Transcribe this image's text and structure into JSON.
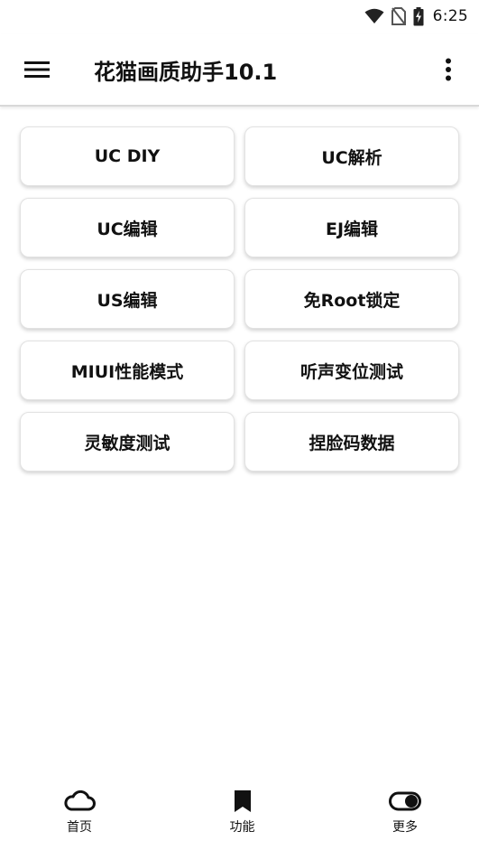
{
  "status_bar": {
    "time": "6:25",
    "icons": [
      "wifi-icon",
      "no-sim-icon",
      "battery-charging-icon"
    ]
  },
  "app_bar": {
    "title": "花猫画质助手10.1",
    "menu_icon": "hamburger-menu-icon",
    "overflow_icon": "more-vert-icon"
  },
  "features": [
    {
      "label": "UC DIY"
    },
    {
      "label": "UC解析"
    },
    {
      "label": "UC编辑"
    },
    {
      "label": "EJ编辑"
    },
    {
      "label": "US编辑"
    },
    {
      "label": "免Root锁定"
    },
    {
      "label": "MIUI性能模式"
    },
    {
      "label": "听声变位测试"
    },
    {
      "label": "灵敏度测试"
    },
    {
      "label": "捏脸码数据"
    }
  ],
  "bottom_nav": [
    {
      "label": "首页",
      "icon": "cloud-icon"
    },
    {
      "label": "功能",
      "icon": "bookmark-icon"
    },
    {
      "label": "更多",
      "icon": "toggle-icon"
    }
  ]
}
